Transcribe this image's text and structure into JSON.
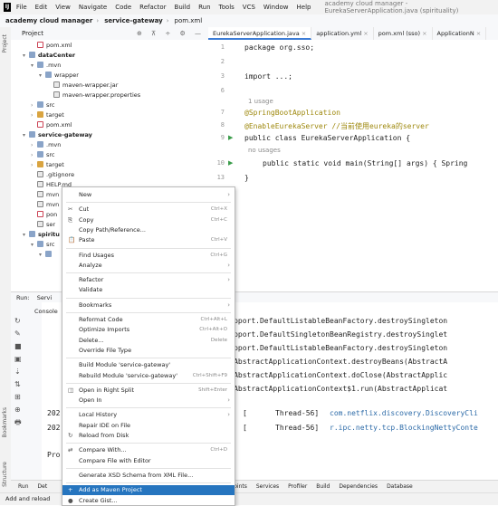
{
  "menubar": {
    "items": [
      "File",
      "Edit",
      "View",
      "Navigate",
      "Code",
      "Refactor",
      "Build",
      "Run",
      "Tools",
      "VCS",
      "Window",
      "Help"
    ],
    "window_title": "academy cloud manager - EurekaServerApplication.java (spirituality)"
  },
  "breadcrumb": {
    "project": "academy cloud manager",
    "module": "service-gateway",
    "file": "pom.xml"
  },
  "project_panel": {
    "title": "Project",
    "tools": "⊕ ⊼ ÷ ⚙ —"
  },
  "tree": [
    {
      "label": "pom.xml",
      "indent": 2,
      "icon": "maven-file"
    },
    {
      "label": "dataCenter",
      "indent": 1,
      "icon": "module",
      "bold": true,
      "arrow": "▾"
    },
    {
      "label": ".mvn",
      "indent": 2,
      "icon": "folder",
      "arrow": "▾"
    },
    {
      "label": "wrapper",
      "indent": 3,
      "icon": "folder",
      "arrow": "▾"
    },
    {
      "label": "maven-wrapper.jar",
      "indent": 4,
      "icon": "jar"
    },
    {
      "label": "maven-wrapper.properties",
      "indent": 4,
      "icon": "properties"
    },
    {
      "label": "src",
      "indent": 2,
      "icon": "folder",
      "arrow": "›"
    },
    {
      "label": "target",
      "indent": 2,
      "icon": "folder-orange",
      "arrow": "›"
    },
    {
      "label": "pom.xml",
      "indent": 2,
      "icon": "maven-file"
    },
    {
      "label": "service-gateway",
      "indent": 1,
      "icon": "module",
      "bold": true,
      "arrow": "▾"
    },
    {
      "label": ".mvn",
      "indent": 2,
      "icon": "folder",
      "arrow": "›"
    },
    {
      "label": "src",
      "indent": 2,
      "icon": "folder",
      "arrow": "›"
    },
    {
      "label": "target",
      "indent": 2,
      "icon": "folder-orange",
      "arrow": "›"
    },
    {
      "label": ".gitignore",
      "indent": 2,
      "icon": "file"
    },
    {
      "label": "HELP.md",
      "indent": 2,
      "icon": "file"
    },
    {
      "label": "mvn",
      "indent": 2,
      "icon": "file"
    },
    {
      "label": "mvn",
      "indent": 2,
      "icon": "file"
    },
    {
      "label": "pon",
      "indent": 2,
      "icon": "maven-file"
    },
    {
      "label": "ser",
      "indent": 2,
      "icon": "file"
    },
    {
      "label": "spiritu",
      "indent": 1,
      "icon": "module",
      "bold": true,
      "arrow": "▾"
    },
    {
      "label": "src",
      "indent": 2,
      "icon": "folder",
      "arrow": "▾"
    },
    {
      "label": "",
      "indent": 3,
      "icon": "folder",
      "arrow": "▾"
    }
  ],
  "tabs": [
    {
      "label": "EurekaServerApplication.java",
      "active": true
    },
    {
      "label": "application.yml"
    },
    {
      "label": "pom.xml (sso)"
    },
    {
      "label": "ApplicationN"
    }
  ],
  "editor": {
    "lines": [
      {
        "n": "1",
        "html": "package org.sso;"
      },
      {
        "n": "2",
        "html": ""
      },
      {
        "n": "3",
        "html": "import ...;"
      },
      {
        "n": "6",
        "html": ""
      },
      {
        "n": "",
        "html": "1 usage"
      },
      {
        "n": "7",
        "html": "@SpringBootApplication"
      },
      {
        "n": "8",
        "html": "@EnableEurekaServer //当前使用eureka的server"
      },
      {
        "n": "9",
        "html": "public class EurekaServerApplication {"
      },
      {
        "n": "",
        "html": "no usages"
      },
      {
        "n": "10",
        "html": "public static void main(String[] args) { Spring"
      },
      {
        "n": "13",
        "html": "}"
      }
    ]
  },
  "run_panel": {
    "tabs": [
      "Run:",
      "Servi"
    ],
    "console_tab": "Console",
    "lines": [
      "ry.support.DefaultListableBeanFactory.destroySingleton",
      "ry.support.DefaultSingletonBeanRegistry.destroySinglet",
      "ry.support.DefaultListableBeanFactory.destroySingleton",
      "port.AbstractApplicationContext.destroyBeans(AbstractA",
      "port.AbstractApplicationContext.doClose(AbstractApplic",
      "port.AbstractApplicationContext$1.run(AbstractApplicat"
    ],
    "log_lines": [
      {
        "prefix": "202",
        "mid": "[",
        "thread": "Thread-56]",
        "cls": "com.netflix.discovery.DiscoveryCli"
      },
      {
        "prefix": "202",
        "mid": "[",
        "thread": "Thread-56]",
        "cls": "r.ipc.netty.tcp.BlockingNettyConte"
      }
    ],
    "pro": "Pro"
  },
  "bottom_tabs": [
    "Run",
    "Det",
    "inal",
    "Endpoints",
    "Services",
    "Profiler",
    "Build",
    "Dependencies",
    "Database"
  ],
  "status": "Add and reload",
  "context_menu": [
    {
      "label": "New",
      "sub": true
    },
    {
      "sep": true
    },
    {
      "label": "Cut",
      "shortcut": "Ctrl+X",
      "icon": "✂"
    },
    {
      "label": "Copy",
      "shortcut": "Ctrl+C",
      "icon": "⎘"
    },
    {
      "label": "Copy Path/Reference..."
    },
    {
      "label": "Paste",
      "shortcut": "Ctrl+V",
      "icon": "📋"
    },
    {
      "sep": true
    },
    {
      "label": "Find Usages",
      "shortcut": "Ctrl+G"
    },
    {
      "label": "Analyze",
      "sub": true
    },
    {
      "sep": true
    },
    {
      "label": "Refactor",
      "sub": true
    },
    {
      "label": "Validate"
    },
    {
      "sep": true
    },
    {
      "label": "Bookmarks",
      "sub": true
    },
    {
      "sep": true
    },
    {
      "label": "Reformat Code",
      "shortcut": "Ctrl+Alt+L"
    },
    {
      "label": "Optimize Imports",
      "shortcut": "Ctrl+Alt+O"
    },
    {
      "label": "Delete...",
      "shortcut": "Delete"
    },
    {
      "label": "Override File Type"
    },
    {
      "sep": true
    },
    {
      "label": "Build Module 'service-gateway'"
    },
    {
      "label": "Rebuild Module 'service-gateway'",
      "shortcut": "Ctrl+Shift+F9"
    },
    {
      "sep": true
    },
    {
      "label": "Open in Right Split",
      "shortcut": "Shift+Enter",
      "icon": "◫"
    },
    {
      "label": "Open In",
      "sub": true
    },
    {
      "sep": true
    },
    {
      "label": "Local History",
      "sub": true
    },
    {
      "label": "Repair IDE on File"
    },
    {
      "label": "Reload from Disk",
      "icon": "↻"
    },
    {
      "sep": true
    },
    {
      "label": "Compare With...",
      "shortcut": "Ctrl+D",
      "icon": "⇄"
    },
    {
      "label": "Compare File with Editor"
    },
    {
      "sep": true
    },
    {
      "label": "Generate XSD Schema from XML File..."
    },
    {
      "sep": true
    },
    {
      "label": "Add as Maven Project",
      "icon": "+",
      "selected": true
    },
    {
      "label": "Create Gist...",
      "icon": "●"
    }
  ]
}
